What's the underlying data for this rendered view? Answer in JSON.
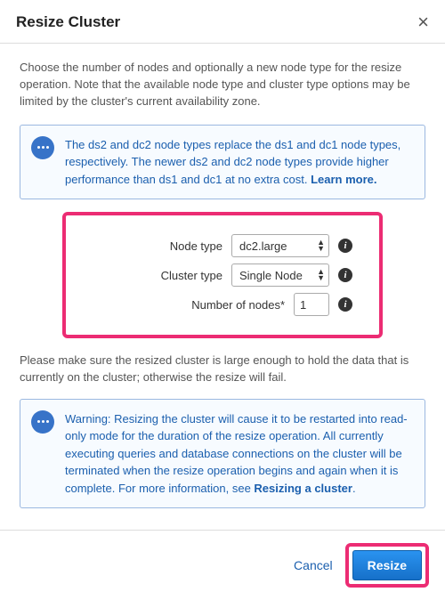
{
  "header": {
    "title": "Resize Cluster"
  },
  "intro": "Choose the number of nodes and optionally a new node type for the resize operation. Note that the available node type and cluster type options may be limited by the cluster's current availability zone.",
  "tip": {
    "text": "The ds2 and dc2 node types replace the ds1 and dc1 node types, respectively. The newer ds2 and dc2 node types provide higher performance than ds1 and dc1 at no extra cost. ",
    "link": "Learn more."
  },
  "form": {
    "node_type_label": "Node type",
    "node_type_value": "dc2.large",
    "cluster_type_label": "Cluster type",
    "cluster_type_value": "Single Node",
    "num_nodes_label": "Number of nodes*",
    "num_nodes_value": "1"
  },
  "size_warning": "Please make sure the resized cluster is large enough to hold the data that is currently on the cluster; otherwise the resize will fail.",
  "restart_warning": {
    "text": "Warning: Resizing the cluster will cause it to be restarted into read-only mode for the duration of the resize operation. All currently executing queries and database connections on the cluster will be terminated when the resize operation begins and again when it is complete. For more information, see ",
    "link": "Resizing a cluster",
    "suffix": "."
  },
  "footer": {
    "cancel": "Cancel",
    "resize": "Resize"
  }
}
